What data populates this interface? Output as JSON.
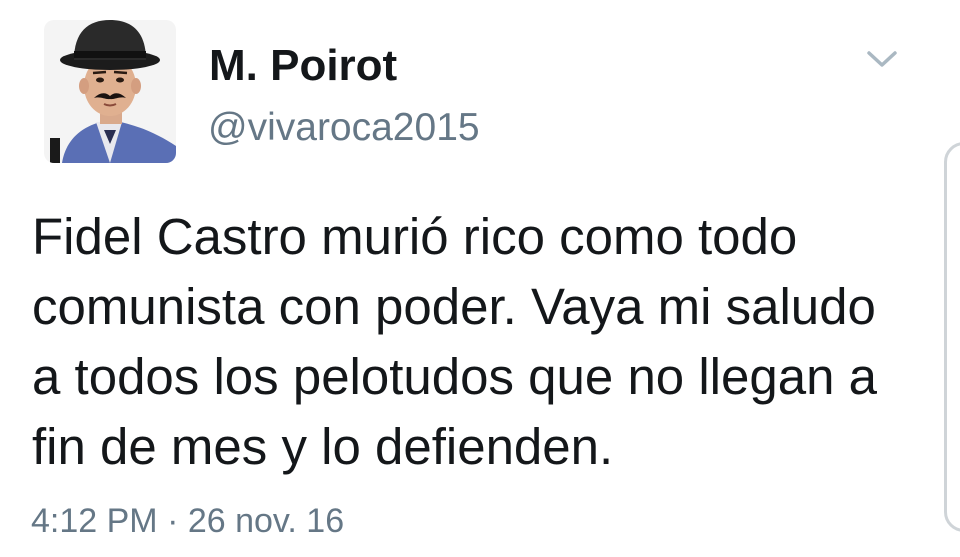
{
  "tweet": {
    "author": {
      "display_name": "M. Poirot",
      "handle": "@vivaroca2015",
      "avatar_icon": "profile-photo-mustached-man-bowler-hat"
    },
    "menu_icon": "chevron-down-icon",
    "text": "Fidel Castro murió rico como todo\ncomunista con poder. Vaya mi saludo\na todos los pelotudos que no llegan a\nfin de mes y lo defienden.",
    "timestamp": "4:12 PM · 26 nov. 16"
  },
  "colors": {
    "text_primary": "#14171a",
    "text_secondary": "#657786",
    "caret": "#aab8c2",
    "background": "#ffffff"
  }
}
